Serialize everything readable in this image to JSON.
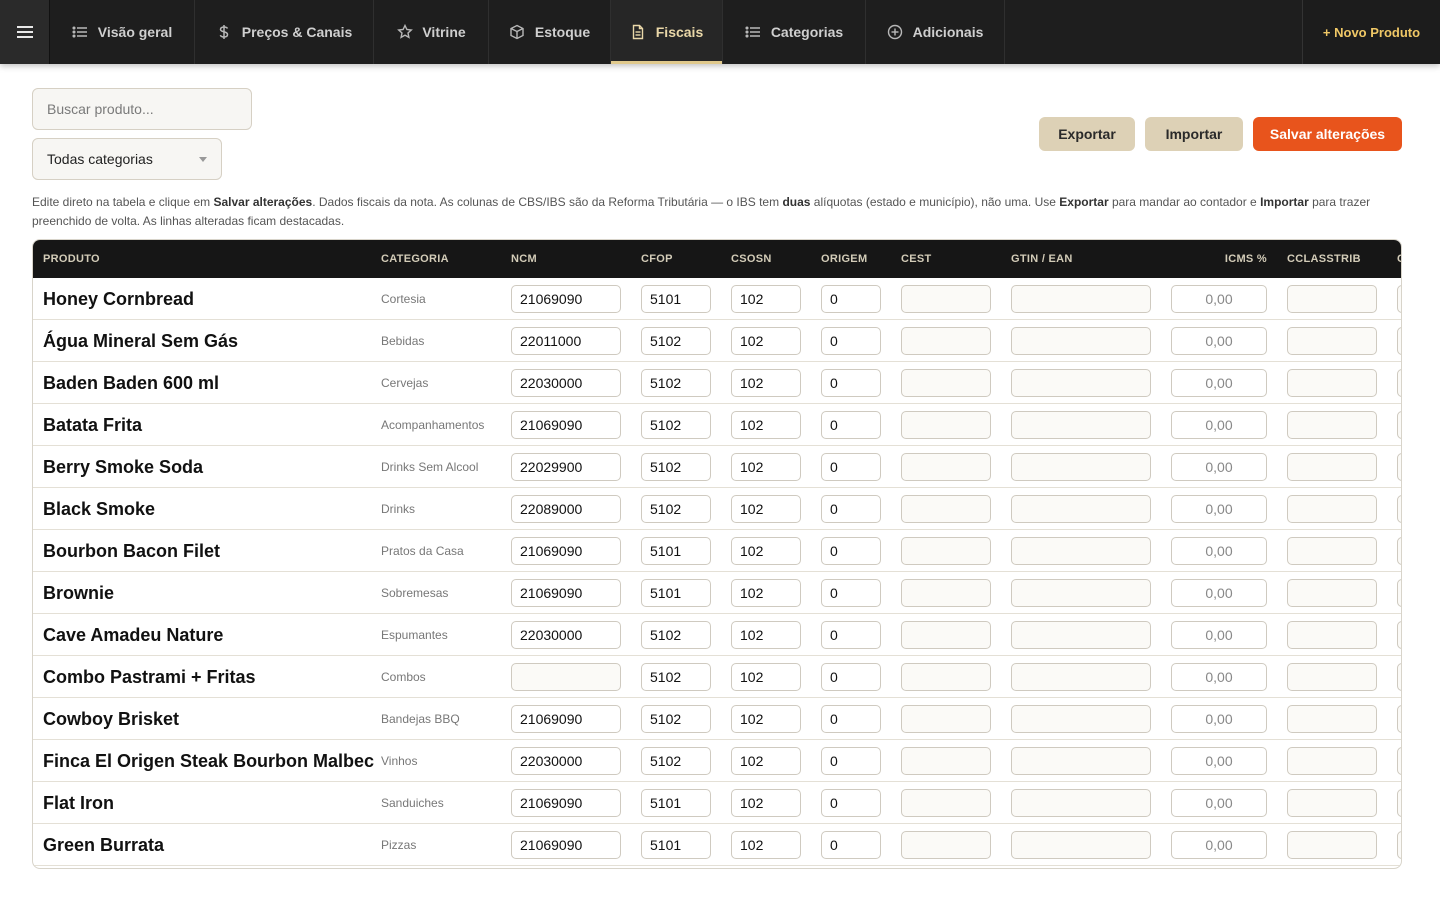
{
  "nav": {
    "tabs": [
      {
        "label": "Visão geral",
        "icon": "list-icon"
      },
      {
        "label": "Preços & Canais",
        "icon": "dollar-icon"
      },
      {
        "label": "Vitrine",
        "icon": "star-icon"
      },
      {
        "label": "Estoque",
        "icon": "box-icon"
      },
      {
        "label": "Fiscais",
        "icon": "document-icon",
        "active": true
      },
      {
        "label": "Categorias",
        "icon": "list-icon"
      },
      {
        "label": "Adicionais",
        "icon": "plus-circle-icon"
      }
    ],
    "new_product": "+ Novo Produto"
  },
  "toolbar": {
    "search_placeholder": "Buscar produto...",
    "category_filter": "Todas categorias",
    "export_label": "Exportar",
    "import_label": "Importar",
    "save_label": "Salvar alterações"
  },
  "help": {
    "p1": "Edite direto na tabela e clique em ",
    "b1": "Salvar alterações",
    "p2": ". Dados fiscais da nota. As colunas de CBS/IBS são da Reforma Tributária — o IBS tem ",
    "b2": "duas",
    "p3": " alíquotas (estado e município), não uma. Use ",
    "b3": "Exportar",
    "p4": " para mandar ao contador e ",
    "b4": "Importar",
    "p5": " para trazer preenchido de volta. As linhas alteradas ficam destacadas."
  },
  "table": {
    "columns": [
      "PRODUTO",
      "CATEGORIA",
      "NCM",
      "CFOP",
      "CSOSN",
      "ORIGEM",
      "CEST",
      "GTIN / EAN",
      "ICMS %",
      "CCLASSTRIB",
      "C"
    ],
    "rows": [
      {
        "name": "Honey Cornbread",
        "category": "Cortesia",
        "ncm": "21069090",
        "cfop": "5101",
        "csosn": "102",
        "origem": "0",
        "cest": "",
        "gtin": "",
        "icms": "0,00",
        "cclasstrib": ""
      },
      {
        "name": "Água Mineral Sem Gás",
        "category": "Bebidas",
        "ncm": "22011000",
        "cfop": "5102",
        "csosn": "102",
        "origem": "0",
        "cest": "",
        "gtin": "",
        "icms": "0,00",
        "cclasstrib": ""
      },
      {
        "name": "Baden Baden 600 ml",
        "category": "Cervejas",
        "ncm": "22030000",
        "cfop": "5102",
        "csosn": "102",
        "origem": "0",
        "cest": "",
        "gtin": "",
        "icms": "0,00",
        "cclasstrib": ""
      },
      {
        "name": "Batata Frita",
        "category": "Acompanhamentos",
        "ncm": "21069090",
        "cfop": "5102",
        "csosn": "102",
        "origem": "0",
        "cest": "",
        "gtin": "",
        "icms": "0,00",
        "cclasstrib": ""
      },
      {
        "name": "Berry Smoke Soda",
        "category": "Drinks Sem Alcool",
        "ncm": "22029900",
        "cfop": "5102",
        "csosn": "102",
        "origem": "0",
        "cest": "",
        "gtin": "",
        "icms": "0,00",
        "cclasstrib": ""
      },
      {
        "name": "Black Smoke",
        "category": "Drinks",
        "ncm": "22089000",
        "cfop": "5102",
        "csosn": "102",
        "origem": "0",
        "cest": "",
        "gtin": "",
        "icms": "0,00",
        "cclasstrib": ""
      },
      {
        "name": "Bourbon Bacon Filet",
        "category": "Pratos da Casa",
        "ncm": "21069090",
        "cfop": "5101",
        "csosn": "102",
        "origem": "0",
        "cest": "",
        "gtin": "",
        "icms": "0,00",
        "cclasstrib": ""
      },
      {
        "name": "Brownie",
        "category": "Sobremesas",
        "ncm": "21069090",
        "cfop": "5101",
        "csosn": "102",
        "origem": "0",
        "cest": "",
        "gtin": "",
        "icms": "0,00",
        "cclasstrib": ""
      },
      {
        "name": "Cave Amadeu Nature",
        "category": "Espumantes",
        "ncm": "22030000",
        "cfop": "5102",
        "csosn": "102",
        "origem": "0",
        "cest": "",
        "gtin": "",
        "icms": "0,00",
        "cclasstrib": ""
      },
      {
        "name": "Combo Pastrami + Fritas",
        "category": "Combos",
        "ncm": "",
        "cfop": "5102",
        "csosn": "102",
        "origem": "0",
        "cest": "",
        "gtin": "",
        "icms": "0,00",
        "cclasstrib": ""
      },
      {
        "name": "Cowboy Brisket",
        "category": "Bandejas BBQ",
        "ncm": "21069090",
        "cfop": "5102",
        "csosn": "102",
        "origem": "0",
        "cest": "",
        "gtin": "",
        "icms": "0,00",
        "cclasstrib": ""
      },
      {
        "name": "Finca El Origen Steak Bourbon Malbec",
        "category": "Vinhos",
        "ncm": "22030000",
        "cfop": "5102",
        "csosn": "102",
        "origem": "0",
        "cest": "",
        "gtin": "",
        "icms": "0,00",
        "cclasstrib": ""
      },
      {
        "name": "Flat Iron",
        "category": "Sanduiches",
        "ncm": "21069090",
        "cfop": "5101",
        "csosn": "102",
        "origem": "0",
        "cest": "",
        "gtin": "",
        "icms": "0,00",
        "cclasstrib": ""
      },
      {
        "name": "Green Burrata",
        "category": "Pizzas",
        "ncm": "21069090",
        "cfop": "5101",
        "csosn": "102",
        "origem": "0",
        "cest": "",
        "gtin": "",
        "icms": "0,00",
        "cclasstrib": ""
      }
    ]
  },
  "colors": {
    "nav_bg": "#1e1e1e",
    "accent_gold": "#e0c98c",
    "save_orange": "#e8541c",
    "secondary_btn": "#ddd1b6"
  }
}
